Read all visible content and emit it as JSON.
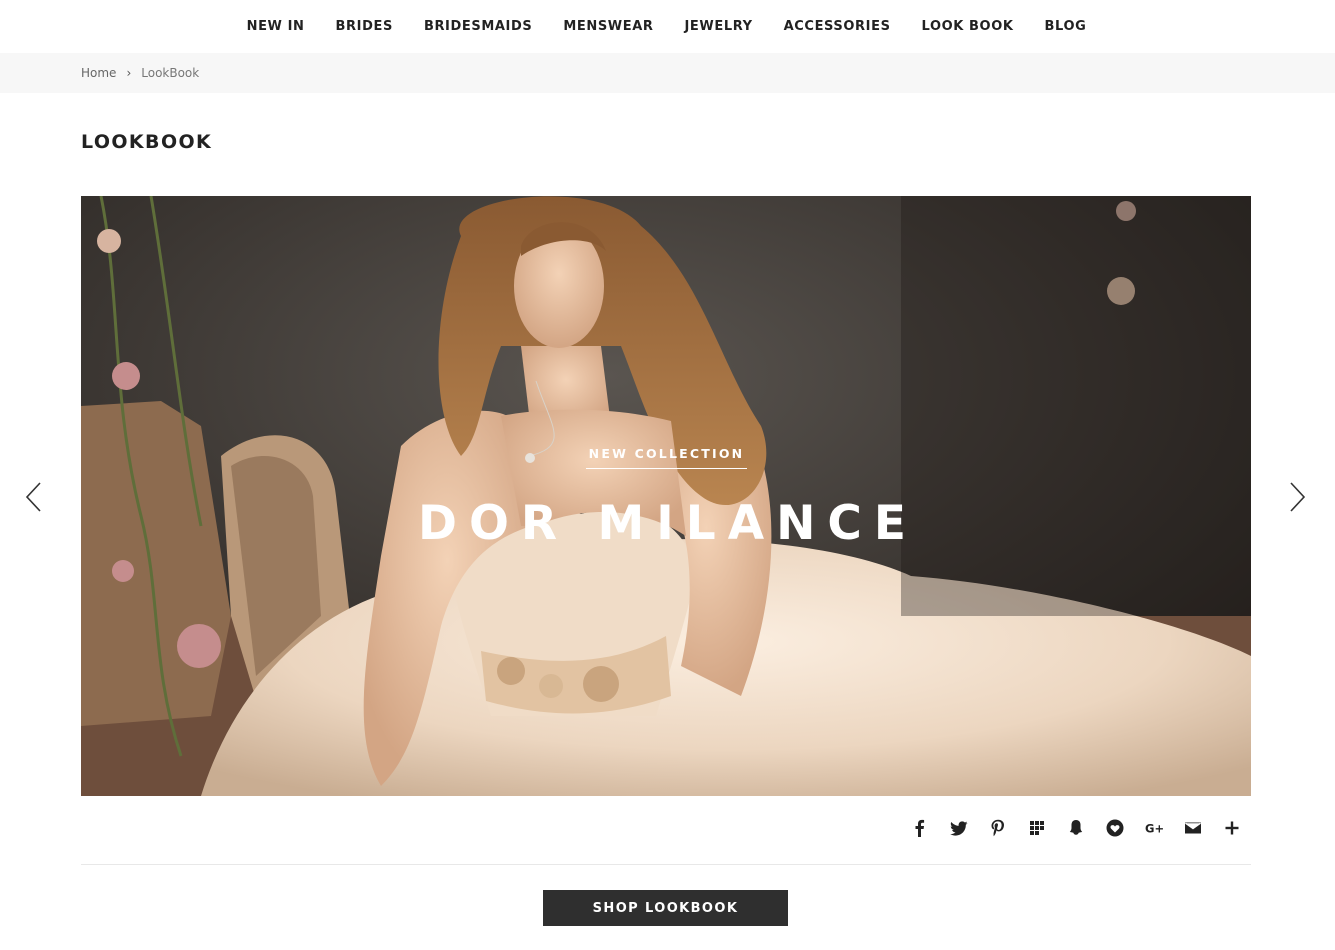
{
  "nav": {
    "items": [
      {
        "label": "NEW IN"
      },
      {
        "label": "BRIDES"
      },
      {
        "label": "BRIDESMAIDS"
      },
      {
        "label": "MENSWEAR"
      },
      {
        "label": "JEWELRY"
      },
      {
        "label": "ACCESSORIES"
      },
      {
        "label": "LOOK BOOK"
      },
      {
        "label": "BLOG"
      }
    ]
  },
  "breadcrumb": {
    "home": "Home",
    "separator": "›",
    "current": "LookBook"
  },
  "page": {
    "title": "LOOKBOOK"
  },
  "hero": {
    "eyebrow": "NEW COLLECTION",
    "title": "DOR MILANCE",
    "image": "bride-in-tulle-gown-photo"
  },
  "carousel": {
    "prev_icon": "chevron-left-icon",
    "next_icon": "chevron-right-icon"
  },
  "share": {
    "icons": [
      "facebook-icon",
      "twitter-icon",
      "pinterest-icon",
      "delicious-icon",
      "snapchat-icon",
      "heart-icon",
      "google-plus-icon",
      "email-icon",
      "plus-icon"
    ],
    "google_plus_text": "G+"
  },
  "actions": {
    "shop_label": "SHOP LOOKBOOK"
  },
  "colors": {
    "text": "#222222",
    "breadcrumb_bg": "#f7f7f7",
    "button_bg": "#2f2f2f",
    "button_text": "#ffffff"
  }
}
